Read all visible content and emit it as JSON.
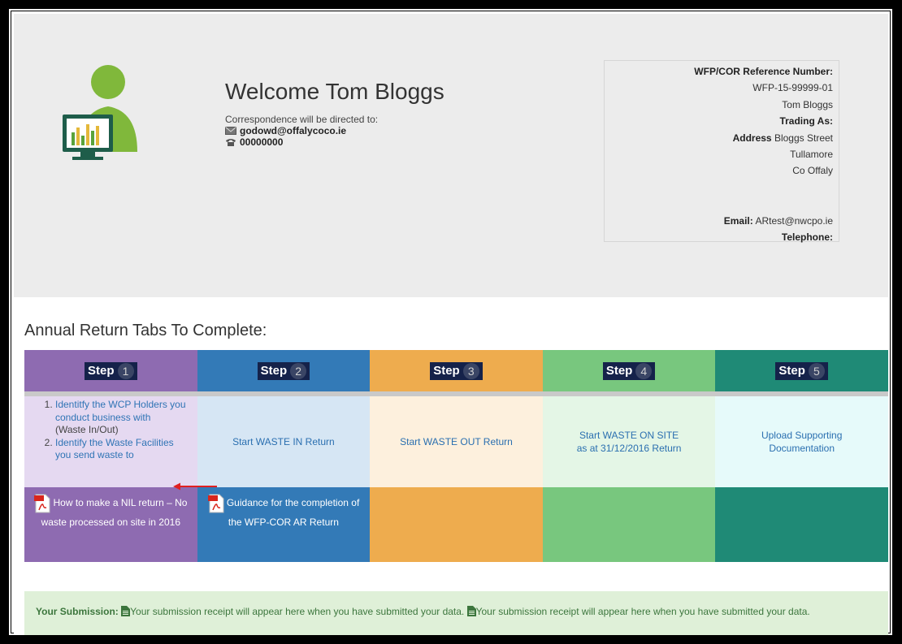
{
  "welcome": {
    "title": "Welcome Tom Bloggs",
    "correspondence_label": "Correspondence will be directed to:",
    "email": "godowd@offalycoco.ie",
    "phone": "00000000"
  },
  "reference": {
    "ref_label": "WFP/COR Reference Number:",
    "ref_value": "WFP-15-99999-01",
    "name": "Tom Bloggs",
    "trading_label": "Trading As:",
    "address_label": "Address",
    "address_line1": "Bloggs Street",
    "address_line2": "Tullamore",
    "address_line3": "Co Offaly",
    "email_label": "Email:",
    "email_value": "ARtest@nwcpo.ie",
    "telephone_label": "Telephone:"
  },
  "tabs_title": "Annual Return Tabs To Complete:",
  "steps": [
    {
      "label": "Step",
      "number": "1",
      "color": "#8e6bb1",
      "body_color": "#e5d9f1",
      "foot_color": "#8e6bb1"
    },
    {
      "label": "Step",
      "number": "2",
      "color": "#337ab7",
      "body_color": "#d6e6f4",
      "foot_color": "#337ab7"
    },
    {
      "label": "Step",
      "number": "3",
      "color": "#eeac4e",
      "body_color": "#fdf0dd",
      "foot_color": "#eeac4e"
    },
    {
      "label": "Step",
      "number": "4",
      "color": "#78c77e",
      "body_color": "#e4f6e6",
      "foot_color": "#78c77e"
    },
    {
      "label": "Step",
      "number": "5",
      "color": "#1f8a76",
      "body_color": "#e6fafa",
      "foot_color": "#1f8a76"
    }
  ],
  "step1": {
    "item1_link": "Identitfy the WCP Holders you conduct business with",
    "item1_note": "(Waste In/Out)",
    "item2_link": "Identify the Waste Facilities you send waste to"
  },
  "step2_link": "Start WASTE IN Return",
  "step3_link": "Start WASTE OUT Return",
  "step4_link_line1": "Start WASTE ON SITE",
  "step4_link_line2": "as at 31/12/2016 Return",
  "step5_link": "Upload Supporting Documentation",
  "foot1": "How to make a NIL return – No waste processed on site in 2016",
  "foot2": "Guidance for the completion of the WFP-COR AR Return",
  "submission": {
    "label": "Your Submission:",
    "text1": "Your submission receipt will appear here when you have submitted your data.",
    "text2": "Your submission receipt will appear here when you have submitted your data."
  }
}
